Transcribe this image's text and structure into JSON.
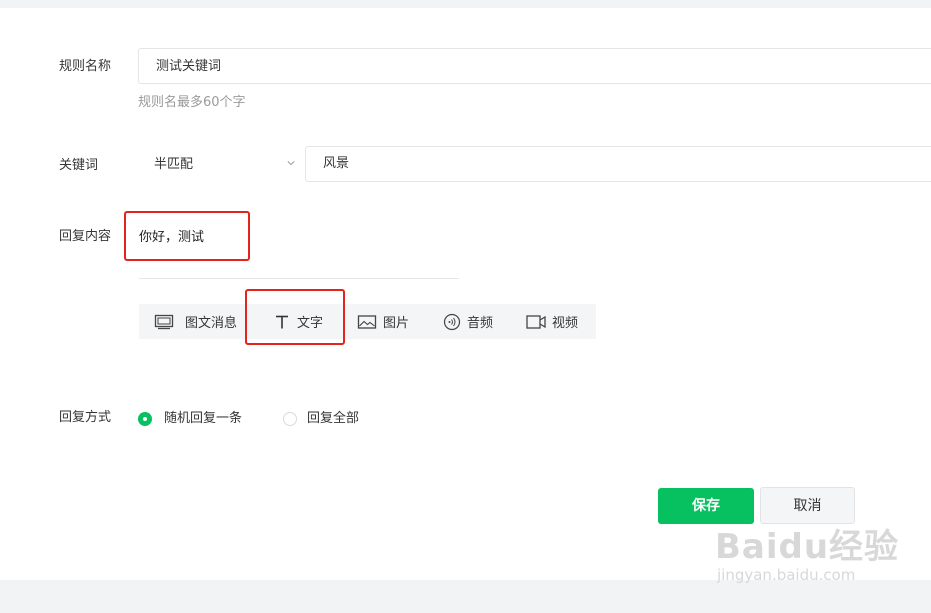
{
  "form": {
    "rule_name": {
      "label": "规则名称",
      "value": "测试关键词",
      "hint": "规则名最多60个字"
    },
    "keyword": {
      "label": "关键词",
      "match_mode": "半匹配",
      "value": "风景"
    },
    "reply_content": {
      "label": "回复内容",
      "text": "你好，测试",
      "toolbar": [
        {
          "icon": "picture-article-icon",
          "label": "图文消息"
        },
        {
          "icon": "text-icon",
          "label": "文字"
        },
        {
          "icon": "image-icon",
          "label": "图片"
        },
        {
          "icon": "audio-icon",
          "label": "音频"
        },
        {
          "icon": "video-icon",
          "label": "视频"
        }
      ]
    },
    "reply_mode": {
      "label": "回复方式",
      "options": [
        {
          "label": "随机回复一条",
          "checked": true
        },
        {
          "label": "回复全部",
          "checked": false
        }
      ]
    }
  },
  "actions": {
    "save_label": "保存",
    "cancel_label": "取消"
  },
  "watermark": {
    "brand": "Baidu经验",
    "url": "jingyan.baidu.com"
  },
  "colors": {
    "primary": "#07c160",
    "highlight": "#e5231d",
    "background_strip": "#f2f3f5"
  }
}
